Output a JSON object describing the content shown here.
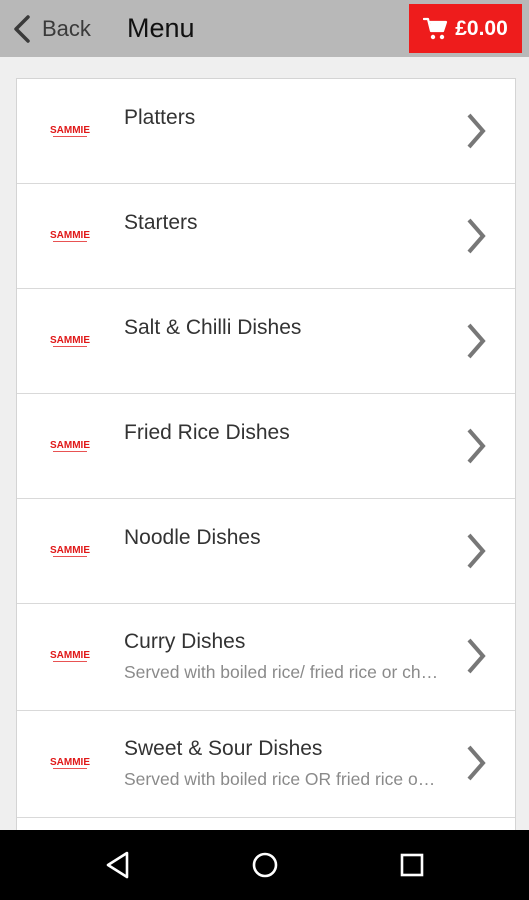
{
  "appbar": {
    "back_label": "Back",
    "title": "Menu",
    "cart_total": "£0.00",
    "cart_color": "#ee1c1c"
  },
  "menu": {
    "items": [
      {
        "title": "Platters",
        "subtitle": ""
      },
      {
        "title": "Starters",
        "subtitle": ""
      },
      {
        "title": "Salt & Chilli Dishes",
        "subtitle": ""
      },
      {
        "title": "Fried Rice Dishes",
        "subtitle": ""
      },
      {
        "title": "Noodle Dishes",
        "subtitle": ""
      },
      {
        "title": "Curry Dishes",
        "subtitle": "Served with boiled rice/ fried rice or chips"
      },
      {
        "title": "Sweet & Sour Dishes",
        "subtitle": "Served with boiled rice OR fried rice or chips"
      }
    ],
    "logo_text": "SAMMIE",
    "logo_color": "#e01818"
  },
  "navbar": {
    "icons": [
      "back-triangle-icon",
      "home-circle-icon",
      "recents-square-icon"
    ]
  }
}
